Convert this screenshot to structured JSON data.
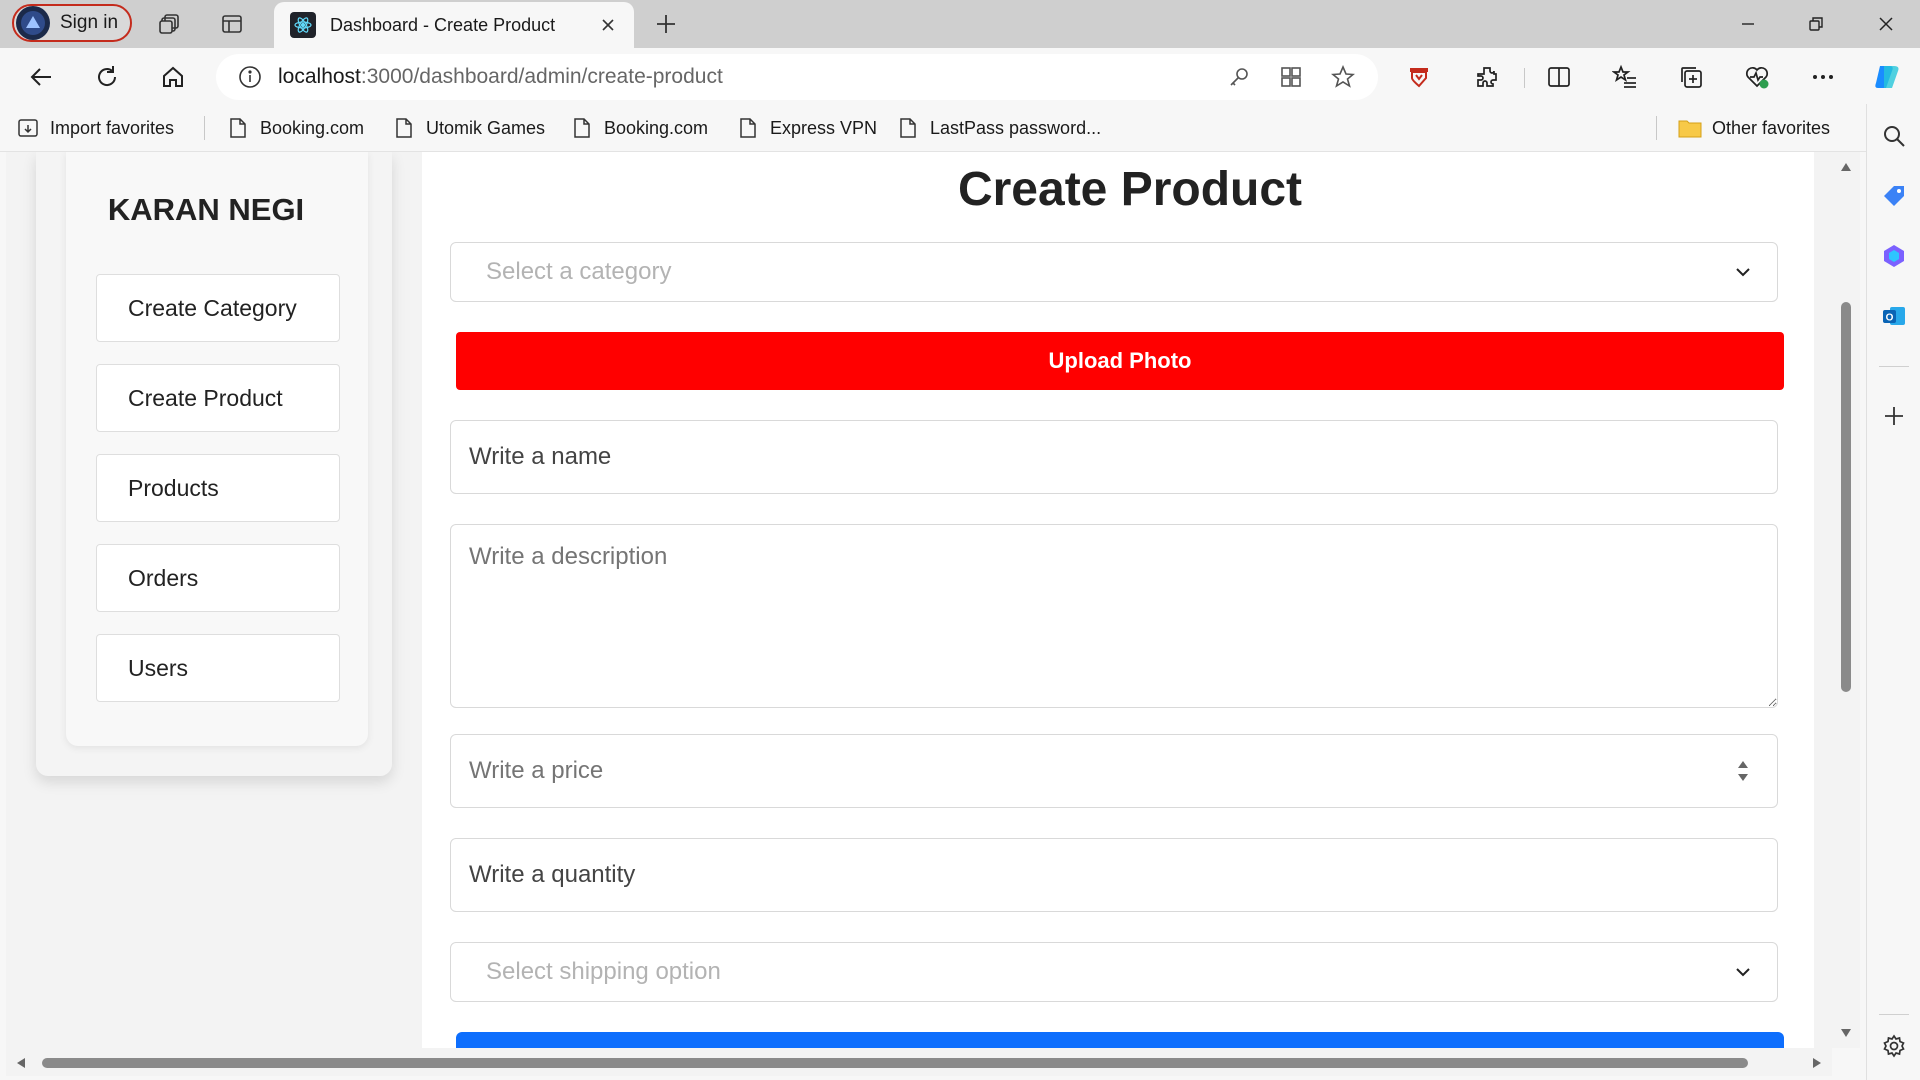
{
  "browser": {
    "signin_label": "Sign in",
    "tab_title": "Dashboard - Create Product",
    "url_host": "localhost",
    "url_path": ":3000/dashboard/admin/create-product"
  },
  "bookmarks": {
    "import": "Import favorites",
    "items": [
      "Booking.com",
      "Utomik Games",
      "Booking.com",
      "Express VPN",
      "LastPass password..."
    ],
    "other": "Other favorites"
  },
  "sidebar": {
    "username": "KARAN NEGI",
    "items": [
      "Create Category",
      "Create Product",
      "Products",
      "Orders",
      "Users"
    ]
  },
  "form": {
    "title": "Create Product",
    "category_placeholder": "Select a category",
    "upload_label": "Upload Photo",
    "name_placeholder": "Write a name",
    "description_placeholder": "Write a description",
    "price_placeholder": "Write a price",
    "quantity_placeholder": "Write a quantity",
    "shipping_placeholder": "Select shipping option"
  },
  "colors": {
    "upload": "#ff0000",
    "submit": "#0d6efd",
    "signin_border": "#c42b1c"
  }
}
